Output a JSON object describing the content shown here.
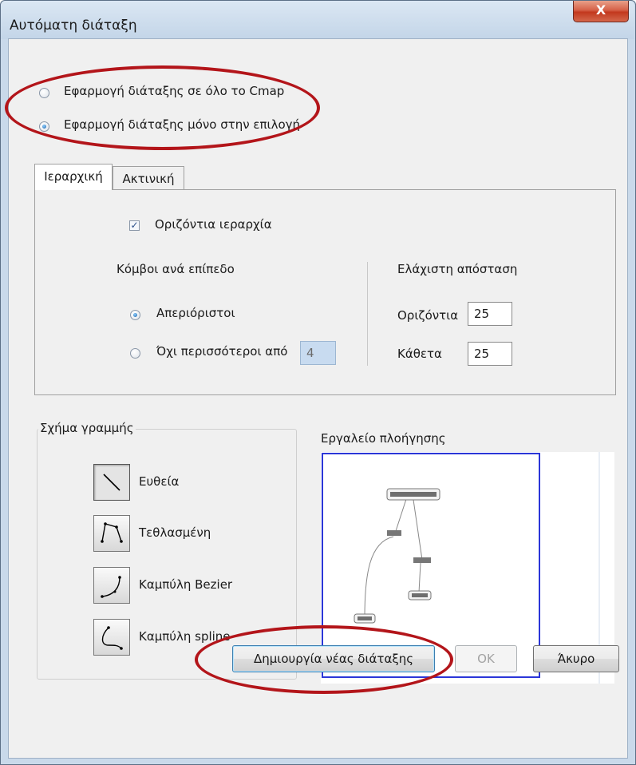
{
  "window": {
    "title": "Αυτόματη διάταξη",
    "close_glyph": "X"
  },
  "scope": {
    "options": [
      {
        "label": "Εφαρμογή διάταξης σε όλο το Cmap",
        "checked": false
      },
      {
        "label": "Εφαρμογή διάταξης μόνο στην επιλογή",
        "checked": true
      }
    ]
  },
  "tabs": [
    {
      "label": "Ιεραρχική",
      "active": true
    },
    {
      "label": "Ακτινική",
      "active": false
    }
  ],
  "hierarchy": {
    "horizontal_checkbox": {
      "label": "Οριζόντια ιεραρχία",
      "checked": true,
      "glyph": "✓"
    },
    "nodes_per_level": {
      "heading": "Κόμβοι ανά επίπεδο",
      "options": [
        {
          "label": "Απεριόριστοι",
          "checked": true
        },
        {
          "label": "Όχι περισσότεροι από",
          "checked": false
        }
      ],
      "max_value": "4"
    },
    "min_distance": {
      "heading": "Ελάχιστη απόσταση",
      "horizontal_label": "Οριζόντια",
      "horizontal_value": "25",
      "vertical_label": "Κάθετα",
      "vertical_value": "25"
    }
  },
  "line_shape": {
    "title": "Σχήμα γραμμής",
    "options": [
      {
        "label": "Ευθεία",
        "icon": "straight-line-icon",
        "selected": true
      },
      {
        "label": "Τεθλασμένη",
        "icon": "polyline-icon",
        "selected": false
      },
      {
        "label": "Καμπύλη Bezier",
        "icon": "bezier-curve-icon",
        "selected": false
      },
      {
        "label": "Καμπύλη spline",
        "icon": "spline-curve-icon",
        "selected": false
      }
    ]
  },
  "navigator": {
    "title": "Εργαλείο πλοήγησης"
  },
  "buttons": {
    "create": "Δημιουργία νέας διάταξης",
    "ok": "OK",
    "cancel": "Άκυρο"
  },
  "colors": {
    "annotation_red": "#b3151a",
    "navigator_border": "#2b36d8",
    "close_button": "#c2381e"
  }
}
